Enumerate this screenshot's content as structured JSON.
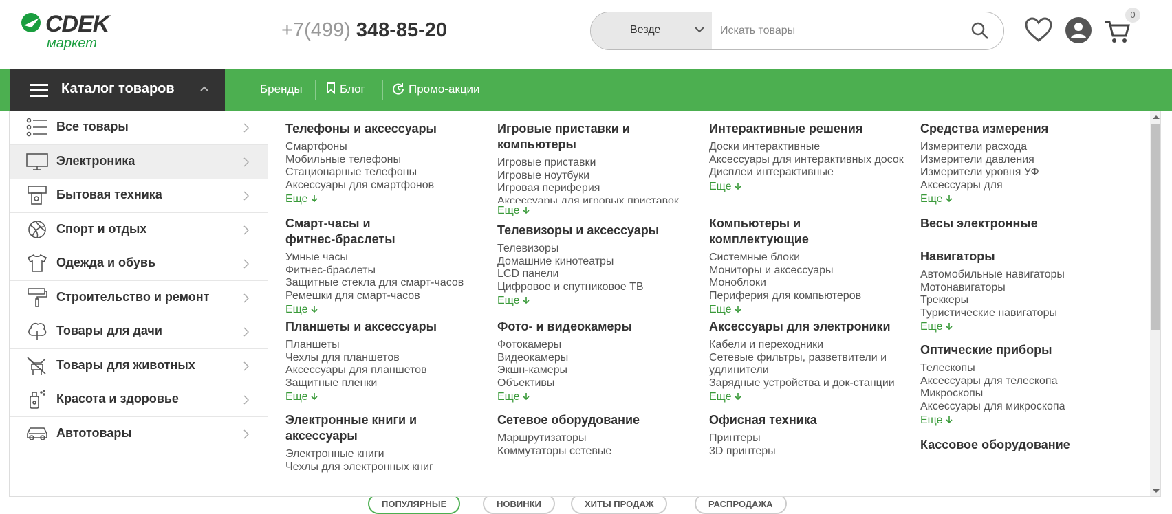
{
  "header": {
    "logo_brand": "CDEK",
    "logo_sub": "маркет",
    "phone_prefix": "+7(499)",
    "phone_number": "348-85-20",
    "search": {
      "scope": "Везде",
      "placeholder": "Искать товары"
    },
    "cart_count": "0"
  },
  "nav": {
    "catalog_label": "Каталог товаров",
    "links": [
      "Бренды",
      "Блог",
      "Промо-акции"
    ]
  },
  "categories": [
    {
      "label": "Все товары",
      "icon": "list-icon",
      "active": false
    },
    {
      "label": "Электроника",
      "icon": "monitor-icon",
      "active": true
    },
    {
      "label": "Бытовая техника",
      "icon": "appliance-icon",
      "active": false
    },
    {
      "label": "Спорт и отдых",
      "icon": "ball-icon",
      "active": false
    },
    {
      "label": "Одежда и обувь",
      "icon": "shirt-icon",
      "active": false
    },
    {
      "label": "Строительство и ремонт",
      "icon": "paint-roller-icon",
      "active": false
    },
    {
      "label": "Товары для дачи",
      "icon": "tree-icon",
      "active": false
    },
    {
      "label": "Товары для животных",
      "icon": "pet-icon",
      "active": false
    },
    {
      "label": "Красота и здоровье",
      "icon": "spray-bottle-icon",
      "active": false
    },
    {
      "label": "Автотовары",
      "icon": "car-icon",
      "active": false
    }
  ],
  "more_label": "Еще",
  "columns": [
    [
      {
        "title": "Телефоны и аксессуары",
        "items": [
          "Смартфоны",
          "Мобильные телефоны",
          "Стационарные телефоны",
          "Аксессуары для смартфонов"
        ],
        "more": true
      },
      {
        "title": "Смарт-часы и фитнес-браслеты",
        "items": [
          "Умные часы",
          "Фитнес-браслеты",
          "Защитные стекла для смарт-часов",
          "Ремешки для смарт-часов"
        ],
        "more": true
      },
      {
        "title": "Планшеты и аксессуары",
        "items": [
          "Планшеты",
          "Чехлы для планшетов",
          "Аксессуары для планшетов",
          "Защитные пленки"
        ],
        "more": true
      },
      {
        "title": "Электронные книги и аксессуары",
        "items": [
          "Электронные книги",
          "Чехлы для электронных книг"
        ],
        "more": false
      }
    ],
    [
      {
        "title": "Игровые приставки и компьютеры",
        "items": [
          "Игровые приставки",
          "Игровые ноутбуки",
          "Игровая периферия",
          "Аксессуары для игровых приставок"
        ],
        "more": true
      },
      {
        "title": "Телевизоры и аксессуары",
        "items": [
          "Телевизоры",
          "Домашние кинотеатры",
          "LCD панели",
          "Цифровое и спутниковое ТВ"
        ],
        "more": true
      },
      {
        "title": "Фото- и видеокамеры",
        "items": [
          "Фотокамеры",
          "Видеокамеры",
          "Экшн-камеры",
          "Объективы"
        ],
        "more": true
      },
      {
        "title": "Сетевое оборудование",
        "items": [
          "Маршрутизаторы",
          "Коммутаторы сетевые"
        ],
        "more": false
      }
    ],
    [
      {
        "title": "Интерактивные решения",
        "items": [
          "Доски интерактивные",
          "Аксессуары для интерактивных досок",
          "Дисплеи интерактивные"
        ],
        "more": true
      },
      {
        "title": "Компьютеры и комплектующие",
        "items": [
          "Системные блоки",
          "Мониторы и аксессуары",
          "Моноблоки",
          "Периферия для компьютеров"
        ],
        "more": true
      },
      {
        "title": "Аксессуары для электроники",
        "items": [
          "Кабели и переходники",
          "Сетевые фильтры, разветвители и удлинители",
          "Зарядные устройства и док-станции"
        ],
        "more": true
      },
      {
        "title": "Офисная техника",
        "items": [
          "Принтеры",
          "3D принтеры"
        ],
        "more": false
      }
    ],
    [
      {
        "title": "Средства измерения",
        "items": [
          "Измерители расхода",
          "Измерители давления",
          "Измерители уровня УФ",
          "Аксессуары для"
        ],
        "more": true
      },
      {
        "title": "Весы электронные",
        "items": [],
        "more": false
      },
      {
        "title": "Навигаторы",
        "items": [
          "Автомобильные навигаторы",
          "Мотонавигаторы",
          "Треккеры",
          "Туристические навигаторы"
        ],
        "more": true
      },
      {
        "title": "Оптические приборы",
        "items": [
          "Телескопы",
          "Аксессуары для телескопа",
          "Микроскопы",
          "Аксессуары для микроскопа"
        ],
        "more": true
      },
      {
        "title": "Кассовое оборудование",
        "items": [],
        "more": false
      }
    ]
  ],
  "bottom_tabs": [
    "ПОПУЛЯРНЫЕ",
    "НОВИНКИ",
    "ХИТЫ ПРОДАЖ",
    "РАСПРОДАЖА"
  ],
  "colors": {
    "green": "#4caf50",
    "dark": "#333333",
    "link_green": "#3a9a3a"
  }
}
